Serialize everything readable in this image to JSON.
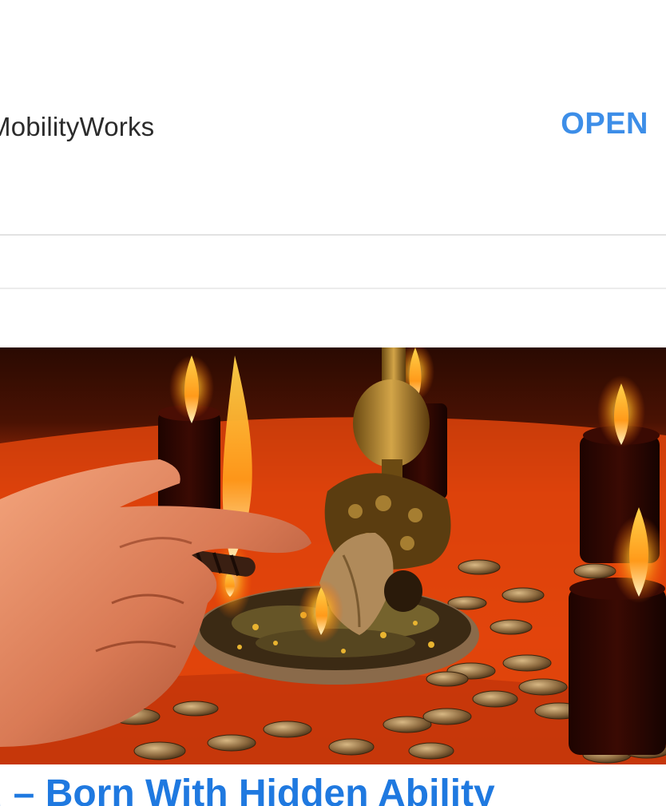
{
  "ad": {
    "advertiser_name": "MobilityWorks",
    "open_label": "OPEN"
  },
  "article": {
    "headline": "u – Born With Hidden Ability",
    "image_icon": "candle-ritual-photo"
  },
  "colors": {
    "accent": "#3d8ee8",
    "headline": "#1f79e0",
    "divider": "#e2e2e2"
  }
}
